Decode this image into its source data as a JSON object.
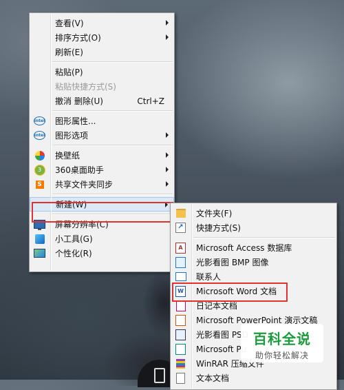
{
  "context_menu": {
    "items": [
      {
        "label": "查看(V)",
        "submenu": true
      },
      {
        "label": "排序方式(O)",
        "submenu": true
      },
      {
        "label": "刷新(E)"
      },
      {
        "label": "粘贴(P)"
      },
      {
        "label": "粘贴快捷方式(S)",
        "disabled": true
      },
      {
        "label": "撤消 删除(U)",
        "shortcut": "Ctrl+Z"
      },
      {
        "label": "图形属性...",
        "icon": "intel-icon"
      },
      {
        "label": "图形选项",
        "icon": "intel-icon",
        "submenu": true
      },
      {
        "label": "换壁纸",
        "icon": "pinwheel-icon",
        "submenu": true
      },
      {
        "label": "360桌面助手",
        "icon": "360-icon",
        "submenu": true
      },
      {
        "label": "共享文件夹同步",
        "icon": "s-icon",
        "submenu": true
      },
      {
        "label": "新建(W)",
        "submenu": true,
        "highlighted": true
      },
      {
        "label": "屏幕分辨率(C)",
        "icon": "monitor-icon"
      },
      {
        "label": "小工具(G)",
        "icon": "gadget-icon"
      },
      {
        "label": "个性化(R)",
        "icon": "personalize-icon"
      }
    ],
    "intel_icon_text": "intel",
    "s_icon_text": "S",
    "icon_360_text": "3"
  },
  "new_submenu": {
    "items": [
      {
        "label": "文件夹(F)",
        "icon": "folder-icon"
      },
      {
        "label": "快捷方式(S)",
        "icon": "shortcut-icon"
      },
      {
        "label": "Microsoft Access 数据库",
        "icon": "access-icon"
      },
      {
        "label": "光影看图 BMP 图像",
        "icon": "bmp-icon"
      },
      {
        "label": "联系人",
        "icon": "contact-icon"
      },
      {
        "label": "Microsoft Word 文档",
        "icon": "word-icon",
        "highlighted": true
      },
      {
        "label": "日记本文档",
        "icon": "journal-icon"
      },
      {
        "label": "Microsoft PowerPoint 演示文稿",
        "icon": "powerpoint-icon"
      },
      {
        "label": "光影看图 PSD",
        "icon": "psd-icon"
      },
      {
        "label": "Microsoft Pu",
        "icon": "publisher-icon"
      },
      {
        "label": "WinRAR 压缩文件",
        "icon": "winrar-icon"
      },
      {
        "label": "文本文档",
        "icon": "text-icon"
      }
    ],
    "shortcut_icon_glyph": "↗",
    "access_icon_text": "A",
    "word_icon_text": "W"
  },
  "watermark": {
    "title": "百科全说",
    "subtitle": "助你轻松解决"
  },
  "colors": {
    "highlight_border": "#e03030",
    "menu_bg": "#f1f1f1",
    "watermark_green": "#1a9b3a"
  }
}
